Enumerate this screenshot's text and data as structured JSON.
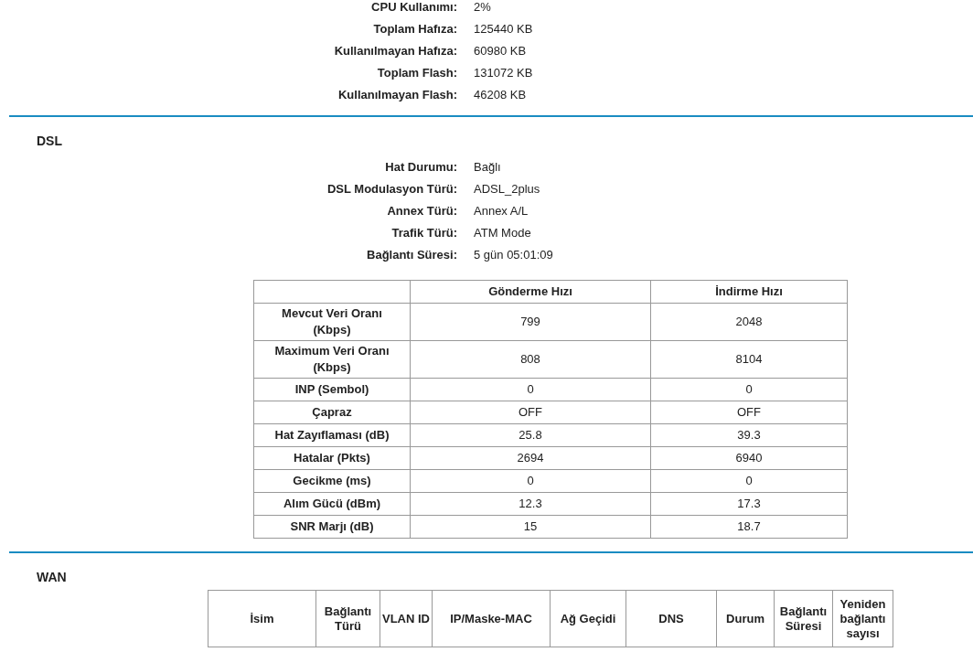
{
  "system_info": [
    {
      "label": "CPU Kullanımı:",
      "value": "2%"
    },
    {
      "label": "Toplam Hafıza:",
      "value": "125440 KB"
    },
    {
      "label": "Kullanılmayan Hafıza:",
      "value": "60980 KB"
    },
    {
      "label": "Toplam Flash:",
      "value": "131072 KB"
    },
    {
      "label": "Kullanılmayan Flash:",
      "value": "46208 KB"
    }
  ],
  "dsl": {
    "title": "DSL",
    "info": [
      {
        "label": "Hat Durumu:",
        "value": "Bağlı"
      },
      {
        "label": "DSL Modulasyon Türü:",
        "value": "ADSL_2plus"
      },
      {
        "label": "Annex Türü:",
        "value": "Annex A/L"
      },
      {
        "label": "Trafik Türü:",
        "value": "ATM Mode"
      },
      {
        "label": "Bağlantı Süresi:",
        "value": "5 gün 05:01:09"
      }
    ],
    "table": {
      "columns": [
        "Gönderme Hızı",
        "İndirme Hızı"
      ],
      "rows": [
        {
          "label": "Mevcut Veri Oranı (Kbps)",
          "cells": [
            "799",
            "2048"
          ]
        },
        {
          "label": "Maximum Veri Oranı (Kbps)",
          "cells": [
            "808",
            "8104"
          ]
        },
        {
          "label": "INP (Sembol)",
          "cells": [
            "0",
            "0"
          ]
        },
        {
          "label": "Çapraz",
          "cells": [
            "OFF",
            "OFF"
          ]
        },
        {
          "label": "Hat Zayıflaması (dB)",
          "cells": [
            "25.8",
            "39.3"
          ]
        },
        {
          "label": "Hatalar (Pkts)",
          "cells": [
            "2694",
            "6940"
          ]
        },
        {
          "label": "Gecikme (ms)",
          "cells": [
            "0",
            "0"
          ]
        },
        {
          "label": "Alım Gücü (dBm)",
          "cells": [
            "12.3",
            "17.3"
          ]
        },
        {
          "label": "SNR Marjı (dB)",
          "cells": [
            "15",
            "18.7"
          ]
        }
      ]
    }
  },
  "wan": {
    "title": "WAN",
    "table": {
      "columns": [
        "İsim",
        "Bağlantı Türü",
        "VLAN ID",
        "IP/Maske-MAC",
        "Ağ Geçidi",
        "DNS",
        "Durum",
        "Bağlantı Süresi",
        "Yeniden bağlantı sayısı"
      ]
    }
  }
}
